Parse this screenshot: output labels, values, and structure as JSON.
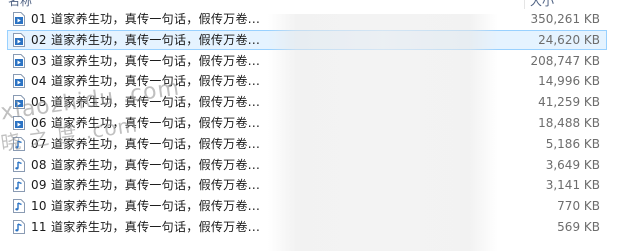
{
  "header": {
    "name_label": "名称",
    "size_label": "大小"
  },
  "files": [
    {
      "name": "01 道家养生功，真传一句话，假传万卷...",
      "size": "350,261 KB",
      "icon": "video-file-icon",
      "selected": false
    },
    {
      "name": "02 道家养生功，真传一句话，假传万卷...",
      "size": "24,620 KB",
      "icon": "video-file-icon",
      "selected": true
    },
    {
      "name": "03 道家养生功，真传一句话，假传万卷...",
      "size": "208,747 KB",
      "icon": "video-file-icon",
      "selected": false
    },
    {
      "name": "04 道家养生功，真传一句话，假传万卷...",
      "size": "14,996 KB",
      "icon": "video-file-icon",
      "selected": false
    },
    {
      "name": "05 道家养生功，真传一句话，假传万卷...",
      "size": "41,259 KB",
      "icon": "video-file-icon",
      "selected": false
    },
    {
      "name": "06 道家养生功，真传一句话，假传万卷...",
      "size": "18,488 KB",
      "icon": "video-file-icon",
      "selected": false
    },
    {
      "name": "07 道家养生功，真传一句话，假传万卷...",
      "size": "5,186 KB",
      "icon": "audio-file-icon",
      "selected": false
    },
    {
      "name": "08 道家养生功，真传一句话，假传万卷...",
      "size": "3,649 KB",
      "icon": "audio-file-icon",
      "selected": false
    },
    {
      "name": "09 道家养生功，真传一句话，假传万卷...",
      "size": "3,141 KB",
      "icon": "audio-file-icon",
      "selected": false
    },
    {
      "name": "10 道家养生功，真传一句话，假传万卷...",
      "size": "770 KB",
      "icon": "audio-file-icon",
      "selected": false
    },
    {
      "name": "11 道家养生功，真传一句话，假传万卷...",
      "size": "569 KB",
      "icon": "audio-file-icon",
      "selected": false
    }
  ],
  "watermark": {
    "line1": "xiaozhidu .com",
    "line2": "晓 之 度 .com"
  },
  "colors": {
    "selected_bg": "#e5f3ff",
    "selected_border": "#99d1ff",
    "video_icon": "#2b73c4",
    "audio_icon": "#2b73c4"
  }
}
